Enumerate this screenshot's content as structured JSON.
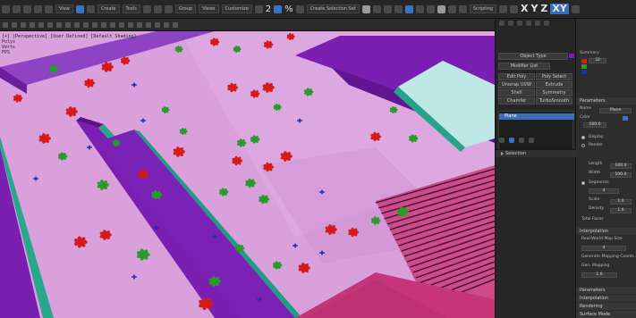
{
  "toolbar": {
    "dropdowns": [
      "View",
      "3",
      "Select",
      "Create Selection Se",
      "Customize"
    ],
    "menu_labels": [
      "Create",
      "Tools",
      "Group",
      "Views",
      "Customize",
      "Scripting",
      "Content"
    ],
    "snap_value": "2",
    "percent_value": "%",
    "selection_set_label": "Create Selection Set",
    "axes": [
      "X",
      "Y",
      "Z",
      "XY"
    ]
  },
  "viewport": {
    "label_lines": [
      "[+] [Perspective] [User Defined] [Default Shading]",
      "Polys",
      "Verts",
      "FPS"
    ]
  },
  "panel": {
    "outliner_buttons": [
      "Object Type",
      "Modifier List",
      "Edit Poly",
      "Poly Select",
      "Unwrap UVW",
      "Extrude",
      "Shell",
      "Symmetry",
      "Chamfer",
      "TurboSmooth"
    ],
    "selected_item": "Plane",
    "rollout_title": "Selection",
    "props_top_label": "Summary",
    "props_heading": "Parameters",
    "props_rows": [
      "Name",
      "Color",
      "Length",
      "Width",
      "Segments",
      "Render",
      "Display",
      "Real-World Map Size",
      "Generate Mapping Coords.",
      "Scale",
      "Density",
      "Total Faces",
      "Gen. Mapping"
    ],
    "field_values": [
      "100.0",
      "100.0",
      "4",
      "4",
      "1.0",
      "1.0",
      "32"
    ],
    "props_sections": [
      "Parameters",
      "Interpolation",
      "Rendering",
      "Surface Mode"
    ]
  },
  "colors": {
    "ground": "#d9a0dc",
    "walls": "#7b1fb3",
    "trim": "#27a88a",
    "floor_cyan": "#bfe7e6",
    "stairs": "#c6357a",
    "plant_red": "#d51a1a",
    "plant_green": "#2a9a2a",
    "plant_blue": "#1f2fb0",
    "selection_blue": "#3d6fb6"
  }
}
